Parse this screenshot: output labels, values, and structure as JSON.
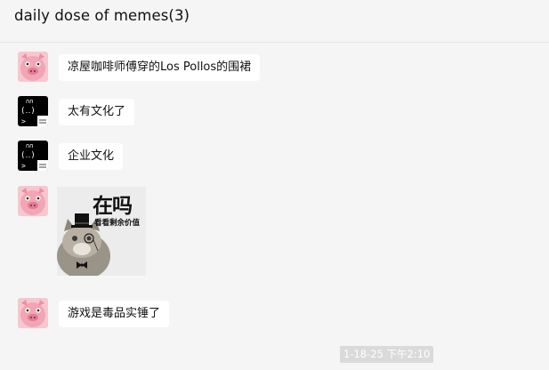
{
  "header": {
    "title": "daily dose of memes(3)"
  },
  "messages": [
    {
      "sender_avatar": "pig-avatar",
      "text": "凉屋咖啡师傅穿的Los Pollos的围裙"
    },
    {
      "sender_avatar": "bunny-terminal-avatar",
      "text": "太有文化了"
    },
    {
      "sender_avatar": "bunny-terminal-avatar",
      "text": "企业文化"
    },
    {
      "sender_avatar": "pig-avatar",
      "sticker": {
        "line1": "在吗",
        "line2": "看看剩余价值",
        "icon": "top-hat-cat-icon"
      }
    },
    {
      "sender_avatar": "pig-avatar",
      "text": "游戏是毒品实锤了"
    }
  ],
  "timestamp": "1-18-25 下午2:10",
  "colors": {
    "background": "#f5f5f5",
    "bubble": "#ffffff",
    "avatar_pink": "#f2a5b4"
  }
}
